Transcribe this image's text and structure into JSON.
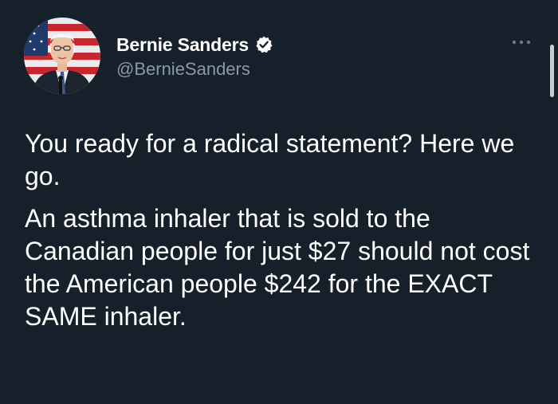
{
  "author": {
    "name": "Bernie Sanders",
    "handle": "@BernieSanders",
    "verified": true
  },
  "menu": {
    "more_icon": "more-horizontal-icon"
  },
  "tweet": {
    "paragraphs": [
      "You ready for a radical statement? Here we go.",
      "An asthma inhaler that is sold to the Canadian people for just $27 should not cost the American people $242 for the EXACT SAME inhaler."
    ]
  },
  "colors": {
    "background": "#15202b",
    "text": "#ffffff",
    "secondary_text": "#8b98a5",
    "verified_badge": "#ffffff"
  }
}
